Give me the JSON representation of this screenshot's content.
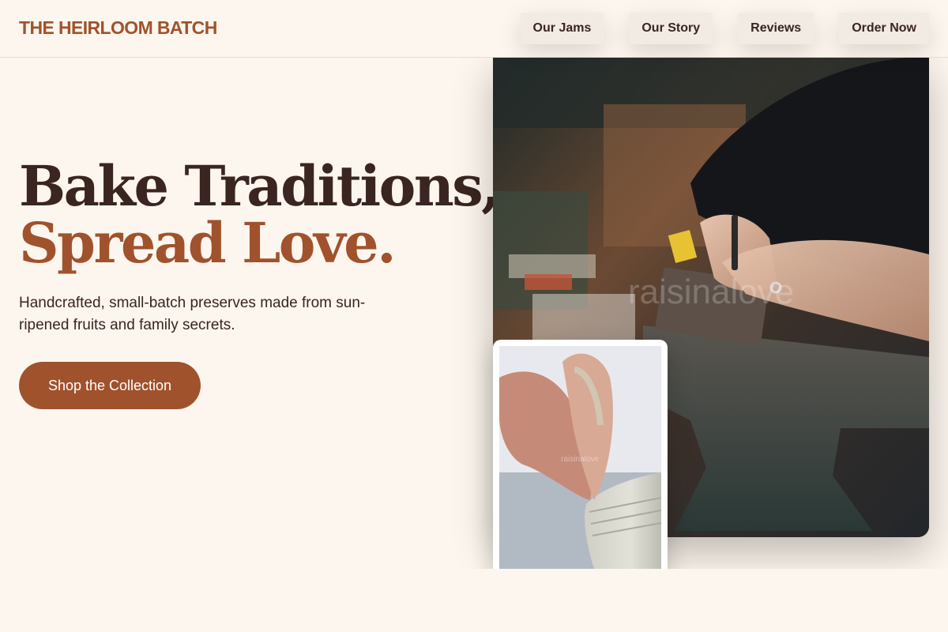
{
  "brand": {
    "name": "THE HEIRLOOM BATCH"
  },
  "nav": {
    "items": [
      {
        "label": "Our Jams"
      },
      {
        "label": "Our Story"
      },
      {
        "label": "Reviews"
      },
      {
        "label": "Order Now"
      }
    ]
  },
  "hero": {
    "title_line1": "Bake Traditions,",
    "title_line2": "Spread Love.",
    "subtitle": "Handcrafted, small-batch preserves made from sun-ripened fruits and family secrets.",
    "cta_label": "Shop the Collection"
  },
  "images": {
    "main_watermark": "raisinalove",
    "small_watermark": "raisinalove"
  },
  "colors": {
    "background": "#fdf6ee",
    "brand": "#a0522d",
    "text_dark": "#3a2520",
    "nav_bg": "#f1ebe4"
  }
}
